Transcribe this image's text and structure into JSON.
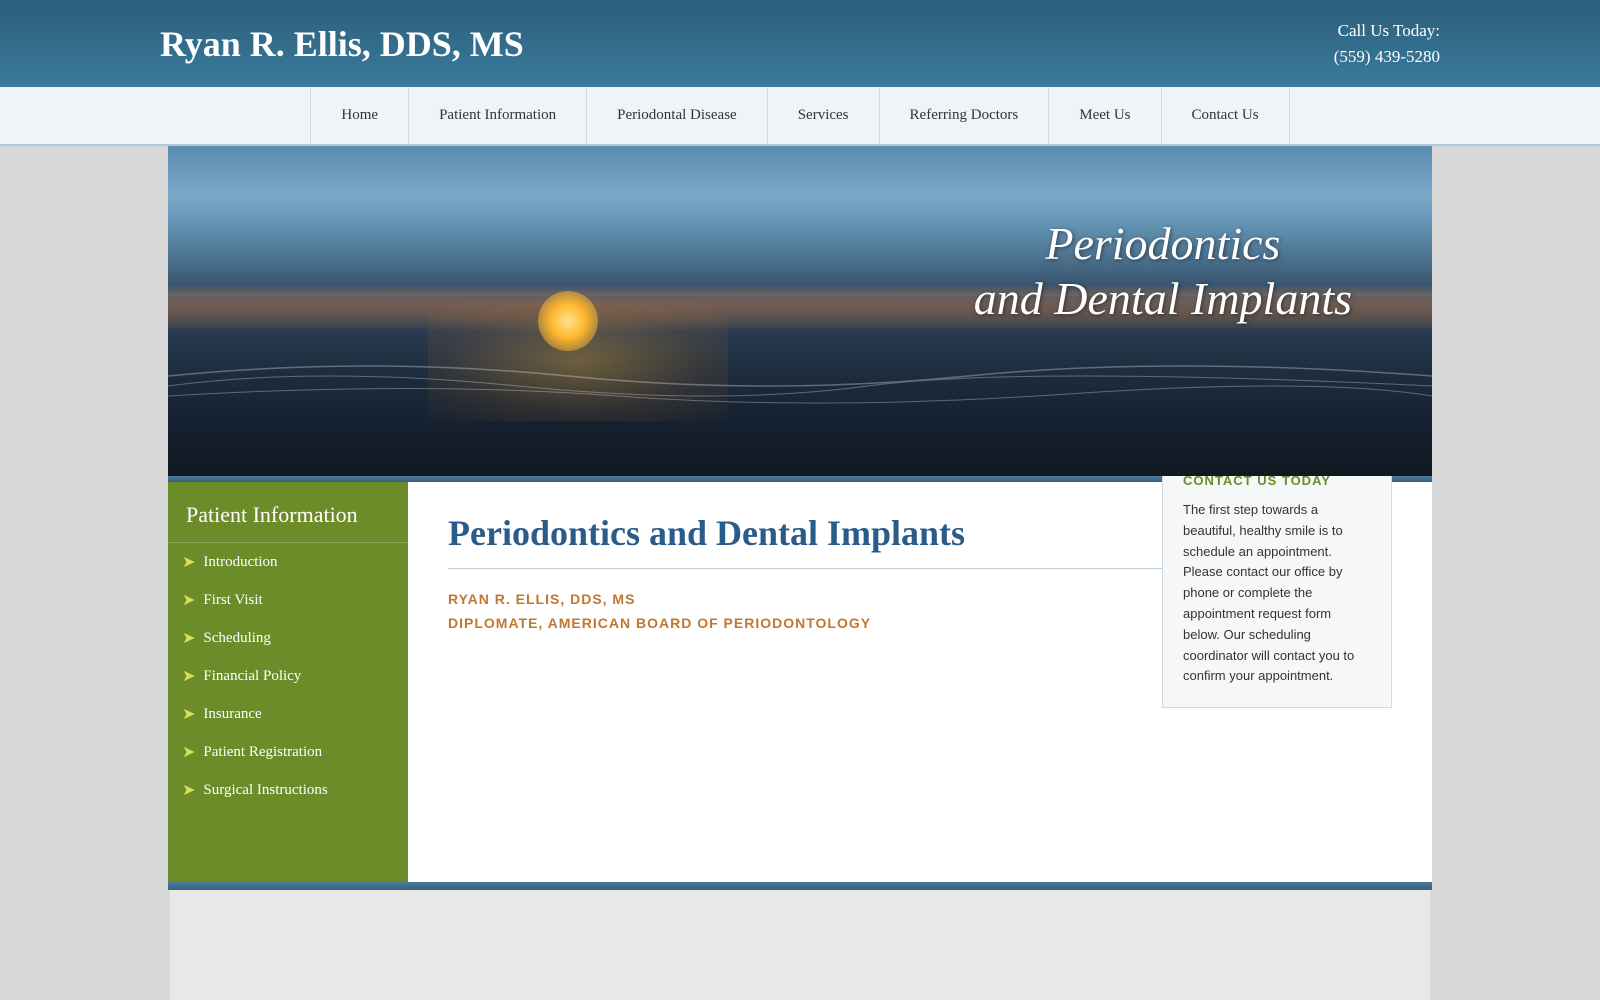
{
  "header": {
    "title": "Ryan R. Ellis, DDS, MS",
    "call_label": "Call Us Today:",
    "phone": "(559) 439-5280"
  },
  "nav": {
    "items": [
      {
        "label": "Home"
      },
      {
        "label": "Patient Information"
      },
      {
        "label": "Periodontal Disease"
      },
      {
        "label": "Services"
      },
      {
        "label": "Referring Doctors"
      },
      {
        "label": "Meet Us"
      },
      {
        "label": "Contact Us"
      }
    ]
  },
  "hero": {
    "line1": "Periodontics",
    "line2": "and Dental Implants"
  },
  "sidebar": {
    "title": "Patient Information",
    "items": [
      {
        "label": "Introduction"
      },
      {
        "label": "First Visit"
      },
      {
        "label": "Scheduling"
      },
      {
        "label": "Financial Policy"
      },
      {
        "label": "Insurance"
      },
      {
        "label": "Patient Registration"
      },
      {
        "label": "Surgical Instructions"
      }
    ]
  },
  "main": {
    "title": "Periodontics and Dental Implants",
    "doctor_name": "RYAN R. ELLIS, DDS, MS",
    "doctor_board": "DIPLOMATE, AMERICAN BOARD OF PERIODONTOLOGY"
  },
  "contact_box": {
    "title": "CONTACT US TODAY",
    "text": "The first step towards a beautiful, healthy smile is to schedule an appointment. Please contact our office by phone or complete the appointment request form below. Our scheduling coordinator will contact you to confirm your appointment."
  }
}
